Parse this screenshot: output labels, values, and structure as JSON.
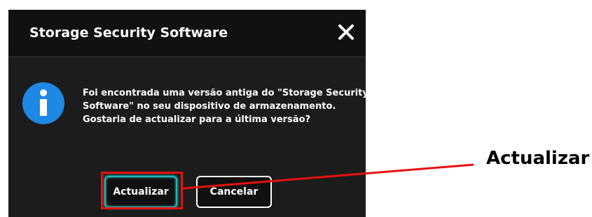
{
  "dialog": {
    "title": "Storage Security Software",
    "message_lines": [
      "Foi encontrada uma versão antiga do \"Storage Security",
      "Software\" no seu dispositivo de armazenamento.",
      "Gostaria de actualizar para a última versão?"
    ],
    "buttons": {
      "update_label": "Actualizar",
      "cancel_label": "Cancelar"
    },
    "icons": {
      "close": "close-icon",
      "info": "info-icon"
    }
  },
  "annotation": {
    "callout_label": "Actualizar",
    "highlight_color": "#e81010"
  },
  "colors": {
    "dialog_bg": "#1c1c1c",
    "header_bg": "#111111",
    "info_blue": "#1e88e5",
    "accent_teal": "#1fb6b6"
  }
}
